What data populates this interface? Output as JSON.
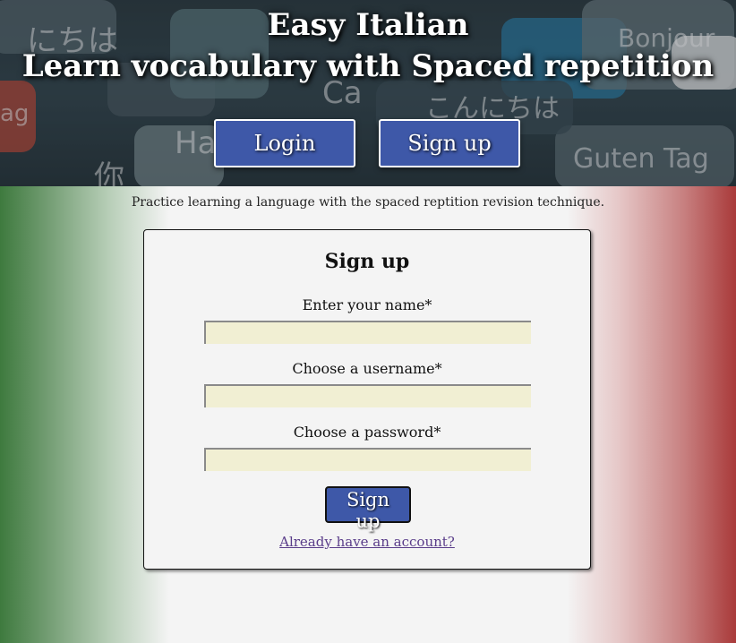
{
  "hero": {
    "title": "Easy Italian",
    "subtitle": "Learn vocabulary with Spaced repetition",
    "login_label": "Login",
    "signup_label": "Sign up",
    "background_words": [
      "にちは",
      "Ca",
      "Hal",
      "Bonjour",
      "こんにちは",
      "Guten Tag",
      "你",
      "ag"
    ]
  },
  "tagline": "Practice learning a language with the spaced reptition revision technique.",
  "form": {
    "title": "Sign up",
    "name_label": "Enter your name*",
    "name_value": "",
    "username_label": "Choose a username*",
    "username_value": "",
    "password_label": "Choose a password*",
    "password_value": "",
    "submit_label": "Sign up",
    "account_link": "Already have an account?"
  },
  "colors": {
    "button_blue": "#3e58a8",
    "input_bg": "#f1efd3",
    "flag_green": "#3e7a3e",
    "flag_red": "#a93a3a",
    "link_purple": "#5a3d8a"
  }
}
